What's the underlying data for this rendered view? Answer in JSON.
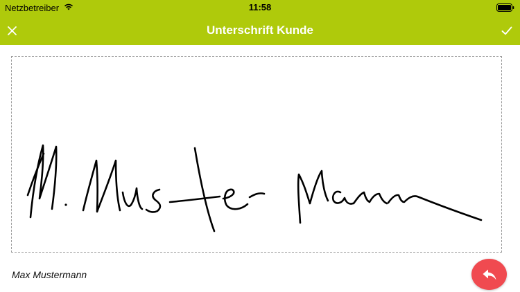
{
  "status_bar": {
    "carrier": "Netzbetreiber",
    "time": "11:58"
  },
  "nav": {
    "title": "Unterschrift Kunde",
    "close_icon": "close-icon",
    "confirm_icon": "checkmark-icon"
  },
  "signature": {
    "signer_name": "Max Mustermann",
    "stroke_color": "#000000"
  },
  "undo_button": {
    "icon": "undo-arrow-icon",
    "color": "#f04a50"
  },
  "colors": {
    "header": "#afca0b",
    "title_text": "#ffffff"
  }
}
